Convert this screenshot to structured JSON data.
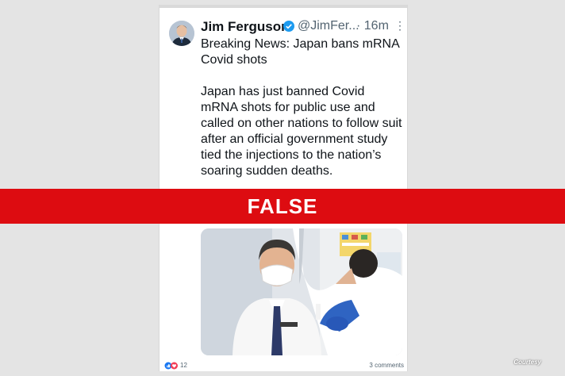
{
  "post": {
    "author": "Jim Ferguson",
    "handle": "@JimFer...",
    "time": "· 16m",
    "more": "⋮",
    "headline": "Breaking News: Japan bans mRNA Covid shots",
    "body": "Japan has just banned Covid mRNA shots for public use and called on other nations to follow suit after an official government study tied the injections to the nation’s soaring sudden deaths.",
    "reaction_count": "12",
    "comments": "3 comments"
  },
  "label": {
    "verdict": "FALSE",
    "courtesy": "Courtesy"
  },
  "colors": {
    "banner": "#dd0c11",
    "verified": "#1d9bf0",
    "background": "#e4e4e4"
  },
  "icons": [
    "verified-badge-icon",
    "more-options-icon",
    "like-reaction-icon",
    "love-reaction-icon"
  ]
}
